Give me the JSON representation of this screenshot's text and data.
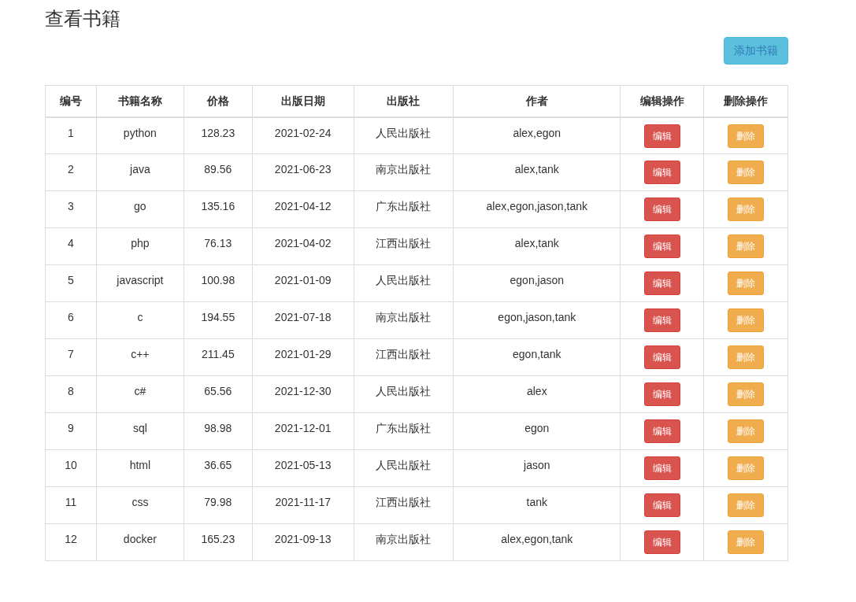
{
  "page_title": "查看书籍",
  "add_button": "添加书籍",
  "table": {
    "columns": [
      "编号",
      "书籍名称",
      "价格",
      "出版日期",
      "出版社",
      "作者",
      "编辑操作",
      "删除操作"
    ],
    "rows": [
      {
        "cells": [
          "1",
          "python",
          "128.23",
          "2021-02-24",
          "人民出版社",
          "alex,egon"
        ],
        "edit_button": "编辑",
        "delete_button": "删除"
      },
      {
        "cells": [
          "2",
          "java",
          "89.56",
          "2021-06-23",
          "南京出版社",
          "alex,tank"
        ],
        "edit_button": "编辑",
        "delete_button": "删除"
      },
      {
        "cells": [
          "3",
          "go",
          "135.16",
          "2021-04-12",
          "广东出版社",
          "alex,egon,jason,tank"
        ],
        "edit_button": "编辑",
        "delete_button": "删除"
      },
      {
        "cells": [
          "4",
          "php",
          "76.13",
          "2021-04-02",
          "江西出版社",
          "alex,tank"
        ],
        "edit_button": "编辑",
        "delete_button": "删除"
      },
      {
        "cells": [
          "5",
          "javascript",
          "100.98",
          "2021-01-09",
          "人民出版社",
          "egon,jason"
        ],
        "edit_button": "编辑",
        "delete_button": "删除"
      },
      {
        "cells": [
          "6",
          "c",
          "194.55",
          "2021-07-18",
          "南京出版社",
          "egon,jason,tank"
        ],
        "edit_button": "编辑",
        "delete_button": "删除"
      },
      {
        "cells": [
          "7",
          "c++",
          "211.45",
          "2021-01-29",
          "江西出版社",
          "egon,tank"
        ],
        "edit_button": "编辑",
        "delete_button": "删除"
      },
      {
        "cells": [
          "8",
          "c#",
          "65.56",
          "2021-12-30",
          "人民出版社",
          "alex"
        ],
        "edit_button": "编辑",
        "delete_button": "删除"
      },
      {
        "cells": [
          "9",
          "sql",
          "98.98",
          "2021-12-01",
          "广东出版社",
          "egon"
        ],
        "edit_button": "编辑",
        "delete_button": "删除"
      },
      {
        "cells": [
          "10",
          "html",
          "36.65",
          "2021-05-13",
          "人民出版社",
          "jason"
        ],
        "edit_button": "编辑",
        "delete_button": "删除"
      },
      {
        "cells": [
          "11",
          "css",
          "79.98",
          "2021-11-17",
          "江西出版社",
          "tank"
        ],
        "edit_button": "编辑",
        "delete_button": "删除"
      },
      {
        "cells": [
          "12",
          "docker",
          "165.23",
          "2021-09-13",
          "南京出版社",
          "alex,egon,tank"
        ],
        "edit_button": "编辑",
        "delete_button": "删除"
      }
    ]
  }
}
